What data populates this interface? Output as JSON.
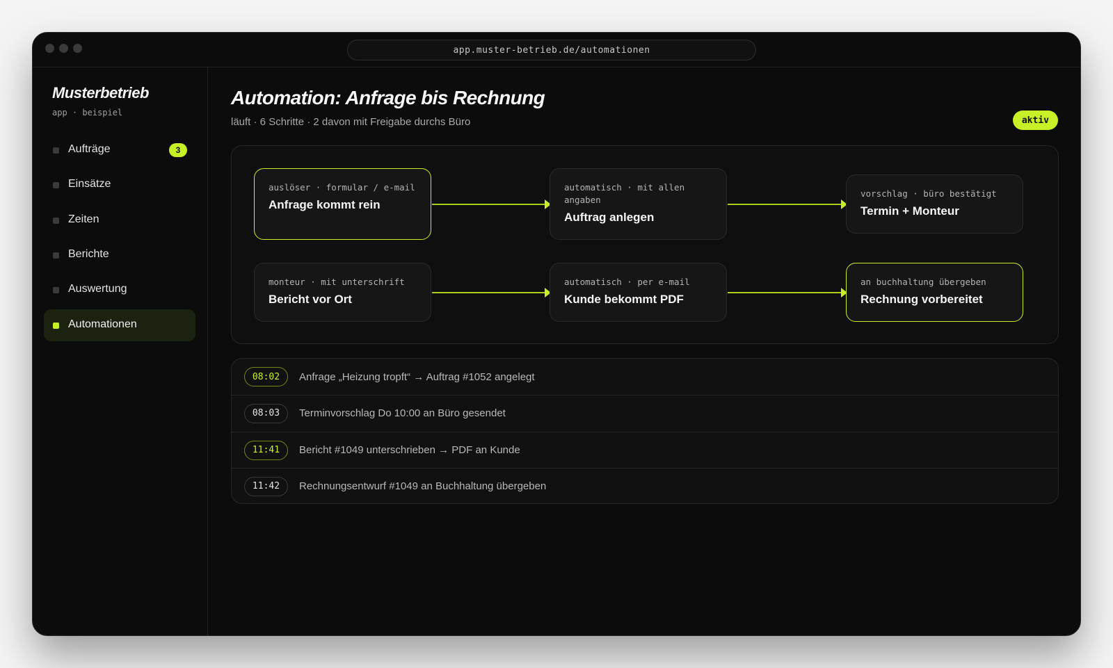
{
  "browser": {
    "url": "app.muster-betrieb.de/automationen"
  },
  "sidebar": {
    "brand": "Musterbetrieb",
    "brand_sub": "app · beispiel",
    "items": [
      {
        "label": "Aufträge",
        "badge": "3",
        "active": false
      },
      {
        "label": "Einsätze",
        "active": false
      },
      {
        "label": "Zeiten",
        "active": false
      },
      {
        "label": "Berichte",
        "active": false
      },
      {
        "label": "Auswertung",
        "active": false
      },
      {
        "label": "Automationen",
        "active": true
      }
    ]
  },
  "main": {
    "title": "Automation: Anfrage bis Rechnung",
    "subtitle": "läuft · 6 Schritte · 2 davon mit Freigabe durchs Büro",
    "status": "aktiv"
  },
  "flow": {
    "steps": [
      {
        "meta": "auslöser · formular / e-mail",
        "name": "Anfrage kommt rein",
        "highlight": true
      },
      {
        "meta": "automatisch · mit allen angaben",
        "name": "Auftrag anlegen",
        "highlight": false
      },
      {
        "meta": "vorschlag · büro bestätigt",
        "name": "Termin + Monteur",
        "highlight": false
      },
      {
        "meta": "monteur · mit unterschrift",
        "name": "Bericht vor Ort",
        "highlight": false
      },
      {
        "meta": "automatisch · per e-mail",
        "name": "Kunde bekommt PDF",
        "highlight": false
      },
      {
        "meta": "an buchhaltung übergeben",
        "name": "Rechnung vorbereitet",
        "highlight": true
      }
    ]
  },
  "log": [
    {
      "time": "08:02",
      "text": "Anfrage „Heizung tropft“ → Auftrag #1052 angelegt",
      "accent": true
    },
    {
      "time": "08:03",
      "text": "Terminvorschlag Do 10:00 an Büro gesendet",
      "accent": false
    },
    {
      "time": "11:41",
      "text": "Bericht #1049 unterschrieben → PDF an Kunde",
      "accent": true
    },
    {
      "time": "11:42",
      "text": "Rechnungsentwurf #1049 an Buchhaltung übergeben",
      "accent": false
    }
  ],
  "colors": {
    "accent": "#c8f026",
    "background": "#0c0c0c"
  }
}
